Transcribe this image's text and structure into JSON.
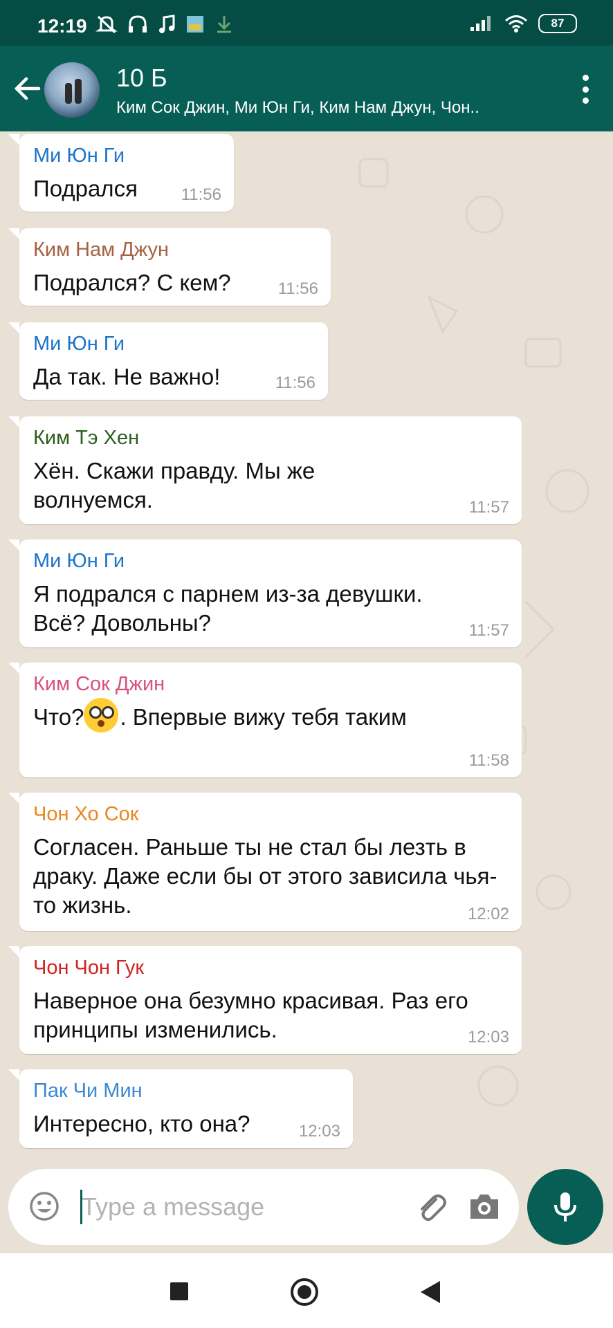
{
  "status_bar": {
    "time": "12:19",
    "battery": "87",
    "icons_left": [
      "mute-icon",
      "headphones-icon",
      "music-icon",
      "gallery-icon",
      "download-icon"
    ],
    "icons_right": [
      "signal-icon",
      "wifi-icon",
      "battery-icon"
    ]
  },
  "header": {
    "title": "10 Б",
    "subtitle": "Ким Сок Джин, Ми Юн Ги, Ким Нам Джун, Чон.."
  },
  "colors": {
    "header_bg": "#075e54",
    "status_bg": "#054d44",
    "chat_bg": "#e9e1d6"
  },
  "messages": [
    {
      "sender": "Ми Юн Ги",
      "color": "#1c74c9",
      "text": "Подрался",
      "time": "11:56"
    },
    {
      "sender": "Ким Нам Джун",
      "color": "#a56243",
      "text": "Подрался? С кем?",
      "time": "11:56"
    },
    {
      "sender": "Ми Юн Ги",
      "color": "#1c74c9",
      "text": "Да так. Не важно!",
      "time": "11:56"
    },
    {
      "sender": "Ким Тэ Хен",
      "color": "#2b5e1e",
      "text": "Хён. Скажи правду. Мы же волнуемся.",
      "time": "11:57"
    },
    {
      "sender": "Ми Юн Ги",
      "color": "#1c74c9",
      "text": "Я подрался с парнем из-за девушки. Всё? Довольны?",
      "time": "11:57"
    },
    {
      "sender": "Ким Сок Джин",
      "color": "#d6537e",
      "text_before": "Что?",
      "text_after": ". Впервые вижу тебя таким",
      "emoji": "flushed-face",
      "time": "11:58"
    },
    {
      "sender": "Чон Хо Сок",
      "color": "#e8861d",
      "text": "Согласен. Раньше ты не стал бы лезть в драку. Даже если бы от этого зависила чья-то жизнь.",
      "time": "12:02"
    },
    {
      "sender": "Чон Чон Гук",
      "color": "#d0231f",
      "text": "Наверное она безумно красивая. Раз его принципы изменились.",
      "time": "12:03"
    },
    {
      "sender": "Пак Чи Мин",
      "color": "#3a88d4",
      "text": "Интересно, кто она?",
      "time": "12:03"
    }
  ],
  "input": {
    "placeholder": "Type a message"
  }
}
